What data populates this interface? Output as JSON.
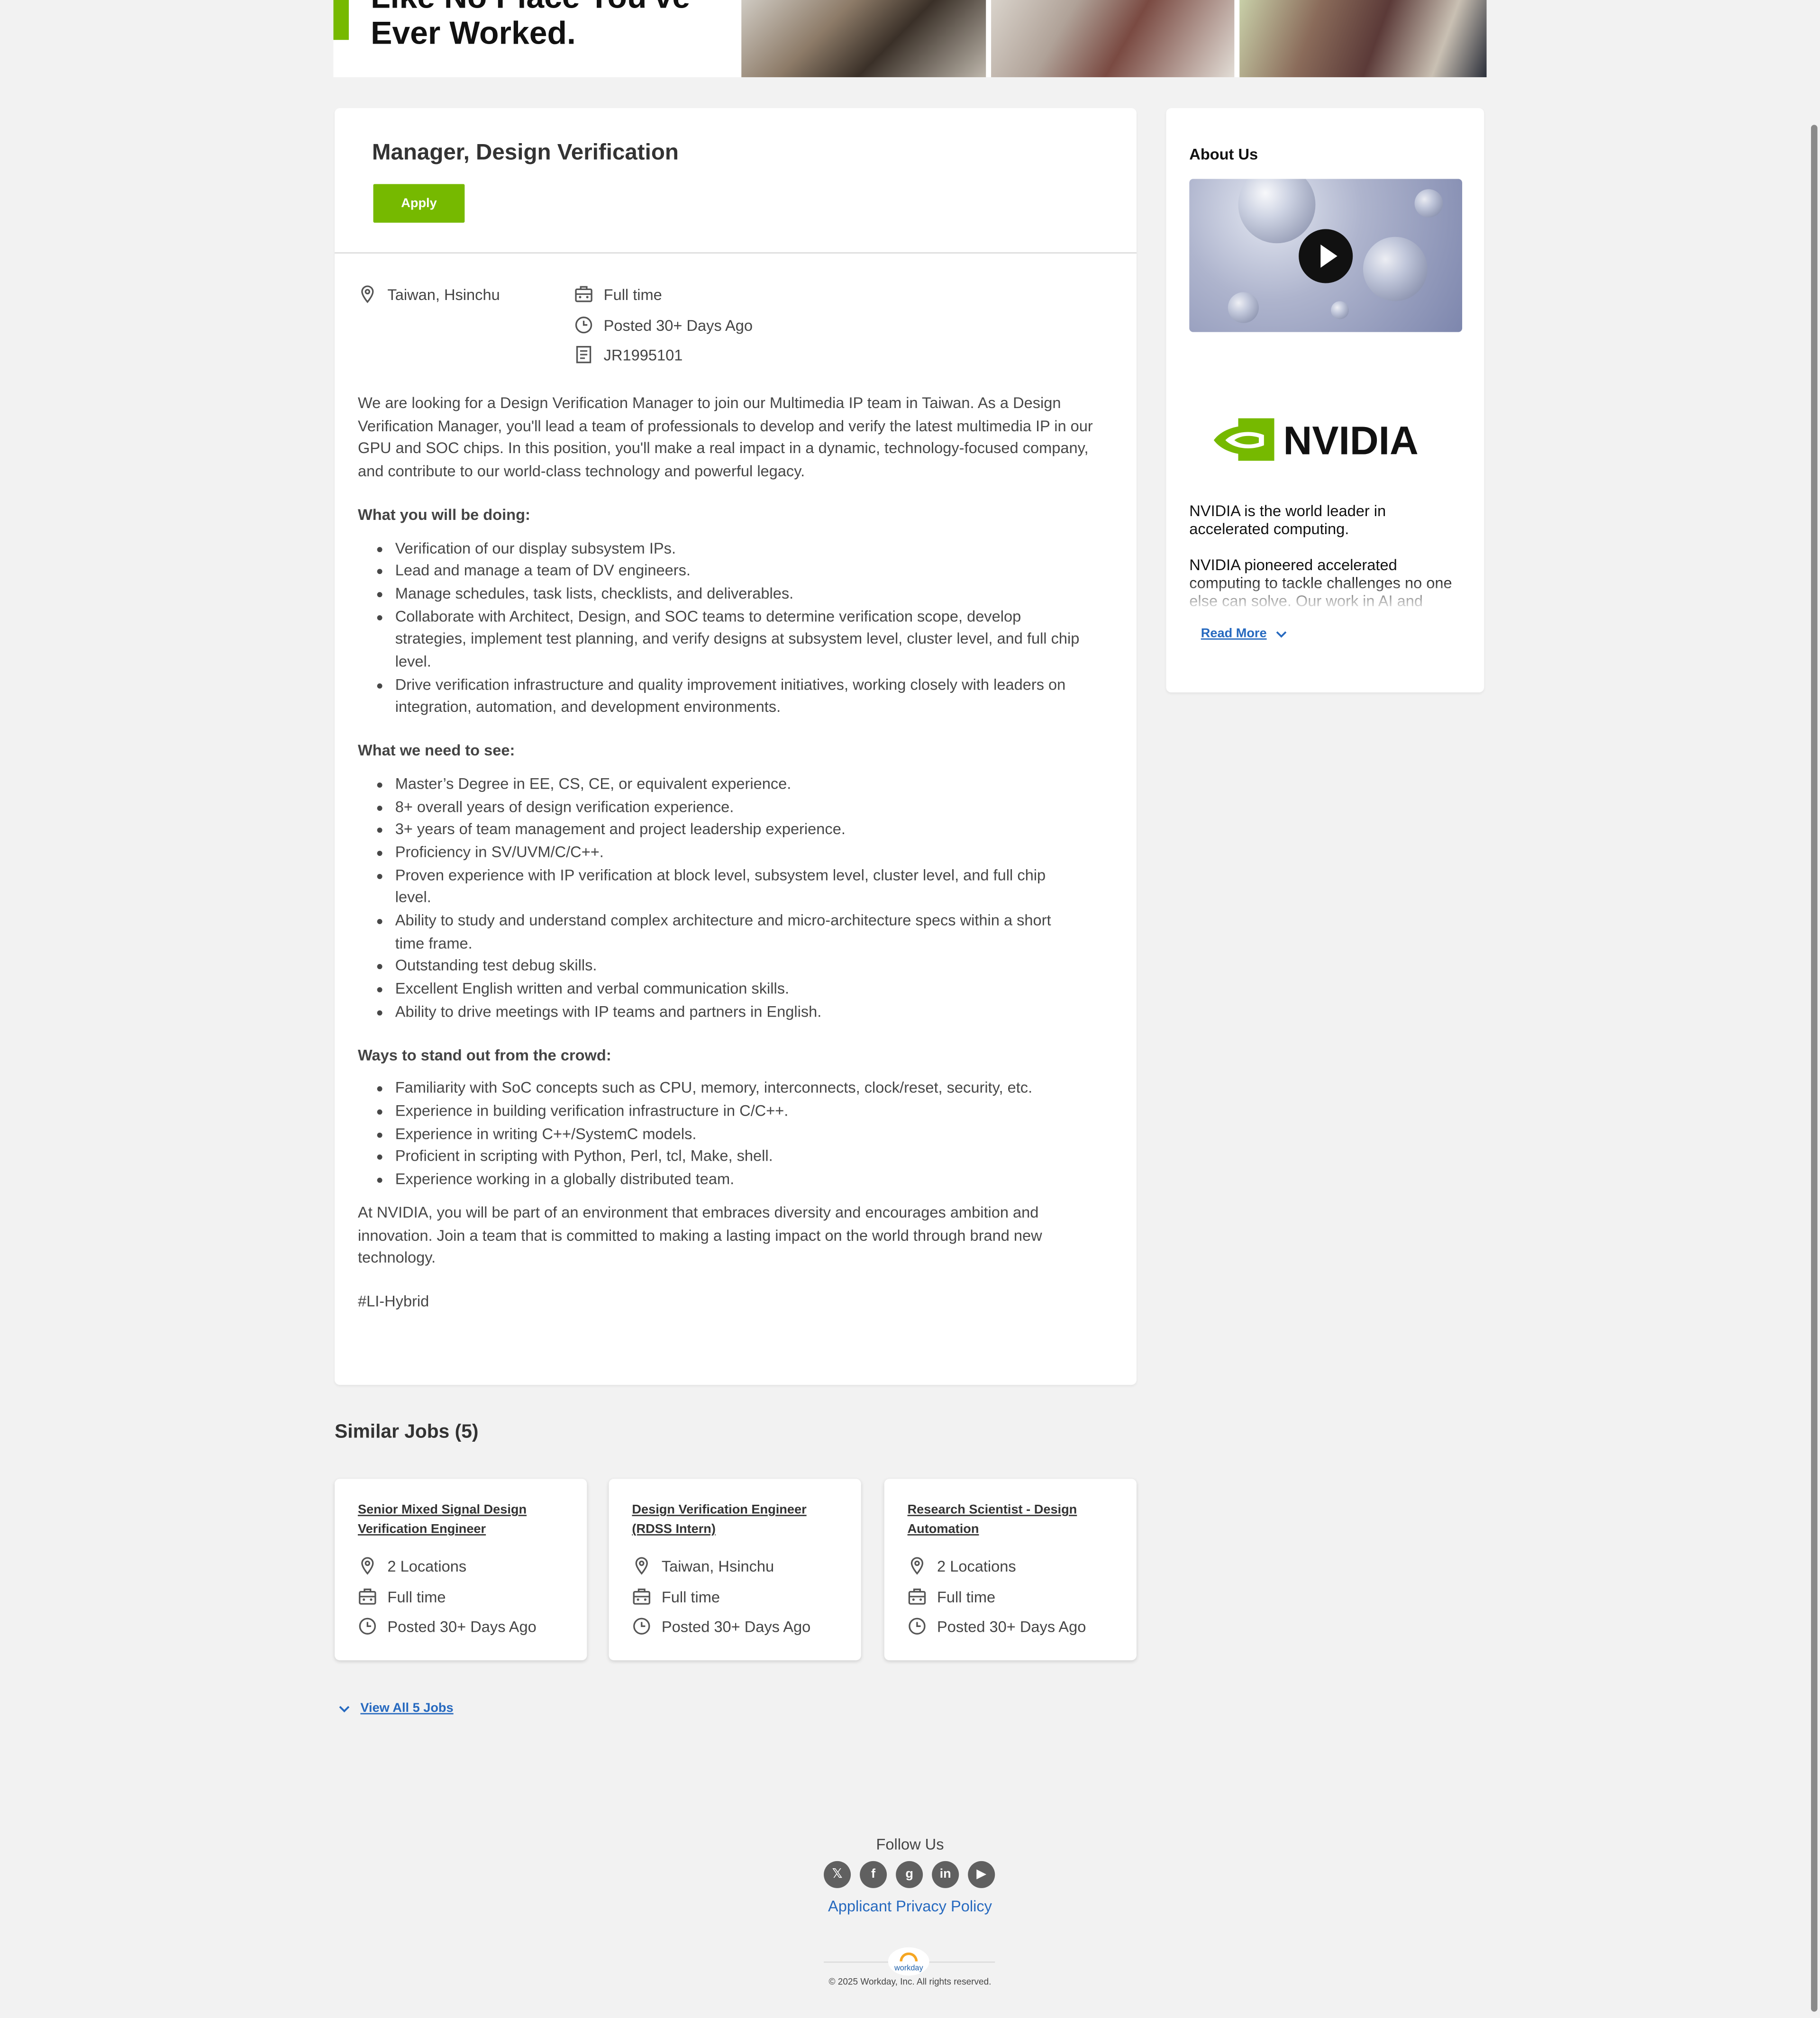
{
  "hero": {
    "line1": "Like No Place You've",
    "line2": "Ever Worked."
  },
  "job": {
    "title": "Manager, Design Verification",
    "apply_label": "Apply",
    "location": "Taiwan, Hsinchu",
    "time_type": "Full time",
    "posted": "Posted 30+ Days Ago",
    "req_id": "JR1995101"
  },
  "description": {
    "intro": "We are looking for a Design Verification Manager to join our Multimedia IP team in Taiwan. As a Design Verification Manager, you'll lead a team of professionals to develop and verify the latest multimedia IP in our GPU and SOC chips. In this position, you'll make a real impact in a dynamic, technology-focused company, and contribute to our world-class technology and powerful legacy.",
    "doing_heading": "What you will be doing:",
    "doing": [
      "Verification of our display subsystem IPs.",
      "Lead and manage a team of DV engineers.",
      "Manage schedules, task lists, checklists, and deliverables.",
      "Collaborate with Architect, Design, and SOC teams to determine verification scope, develop strategies, implement test planning, and verify designs at subsystem level, cluster level, and full chip level.",
      "Drive verification infrastructure and quality improvement initiatives, working closely with leaders on integration, automation, and development environments."
    ],
    "need_heading": "What we need to see:",
    "need": [
      "Master’s Degree in EE, CS, CE, or equivalent experience.",
      "8+ overall years of design verification experience.",
      "3+ years of team management and project leadership experience.",
      "Proficiency in SV/UVM/C/C++.",
      "Proven experience with IP verification at block level, subsystem level, cluster level, and full chip level.",
      "Ability to study and understand complex architecture and micro-architecture specs within a short time frame.",
      "Outstanding test debug skills.",
      "Excellent English written and verbal communication skills.",
      "Ability to drive meetings with IP teams and partners in English."
    ],
    "standout_heading": "Ways to stand out from the crowd:",
    "standout": [
      "Familiarity with SoC concepts such as CPU, memory, interconnects, clock/reset, security, etc.",
      "Experience in building verification infrastructure in C/C++.",
      "Experience in writing C++/SystemC models.",
      "Proficient in scripting with Python, Perl, tcl, Make, shell.",
      "Experience working in a globally distributed team."
    ],
    "closing": "At NVIDIA, you will be part of an environment that embraces diversity and encourages ambition and innovation. Join a team that is committed to making a lasting impact on the world through brand new technology.",
    "tag": "#LI-Hybrid"
  },
  "about": {
    "title": "About Us",
    "logo_text": "NVIDIA",
    "para1": "NVIDIA is the world leader in accelerated computing.",
    "para2": "NVIDIA pioneered accelerated computing to tackle challenges no one else can solve. Our work in AI and digital",
    "read_more": "Read More"
  },
  "similar": {
    "title": "Similar Jobs (5)",
    "jobs": [
      {
        "title": "Senior Mixed Signal Design Verification Engineer",
        "location": "2 Locations",
        "time_type": "Full time",
        "posted": "Posted 30+ Days Ago"
      },
      {
        "title": "Design Verification Engineer (RDSS Intern)",
        "location": "Taiwan, Hsinchu",
        "time_type": "Full time",
        "posted": "Posted 30+ Days Ago"
      },
      {
        "title": "Research Scientist - Design Automation",
        "location": "2 Locations",
        "time_type": "Full time",
        "posted": "Posted 30+ Days Ago"
      }
    ],
    "view_all": "View All 5 Jobs"
  },
  "footer": {
    "follow": "Follow Us",
    "socials": [
      "x-icon",
      "facebook-icon",
      "glassdoor-icon",
      "linkedin-icon",
      "youtube-icon"
    ],
    "social_glyphs": [
      "𝕏",
      "f",
      "g",
      "in",
      "▶"
    ],
    "privacy": "Applicant Privacy Policy",
    "workday": "workday",
    "copyright": "© 2025 Workday, Inc. All rights reserved."
  },
  "colors": {
    "accent": "#76b900",
    "link": "#2669bf",
    "background": "#f2f2f2"
  }
}
